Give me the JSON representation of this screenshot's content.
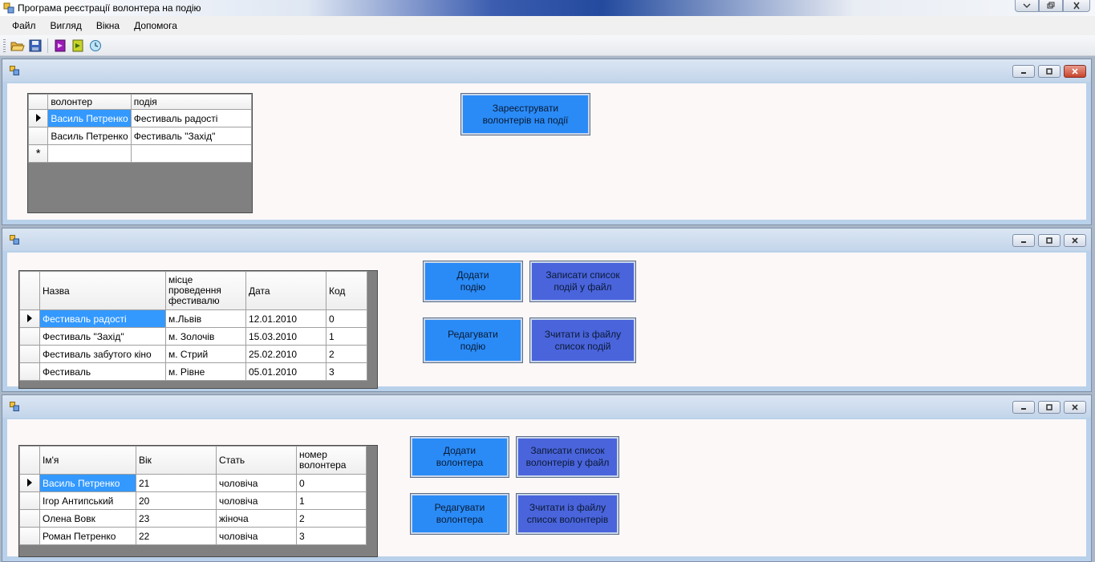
{
  "window": {
    "title": "Програма реєстрації волонтера на подію"
  },
  "menu": {
    "items": [
      "Файл",
      "Вигляд",
      "Вікна",
      "Допомога"
    ]
  },
  "toolbar": {
    "icons": [
      "open-folder-icon",
      "save-icon",
      "purple-book-icon",
      "yellow-book-icon",
      "clock-icon"
    ]
  },
  "registration": {
    "columns": [
      "волонтер",
      "подія"
    ],
    "rows": [
      [
        "Василь Петренко",
        "Фестиваль радості"
      ],
      [
        "Василь Петренко",
        "Фестиваль \"Захід\""
      ]
    ],
    "new_row_marker": "*",
    "register_button": "Зареєструвати волонтерів на події"
  },
  "events": {
    "columns": [
      "Назва",
      "місце проведення фестивалю",
      "Дата",
      "Код"
    ],
    "rows": [
      [
        "Фестиваль радості",
        "м.Львів",
        "12.01.2010",
        "0"
      ],
      [
        "Фестиваль \"Захід\"",
        "м. Золочів",
        "15.03.2010",
        "1"
      ],
      [
        "Фестиваль забутого кіно",
        "м. Стрий",
        "25.02.2010",
        "2"
      ],
      [
        "Фестиваль",
        "м.  Рівне",
        "05.01.2010",
        "3"
      ]
    ],
    "buttons": {
      "add": "Додати подію",
      "save": "Записати список подій у файл",
      "edit": "Редагувати подію",
      "load": "Зчитати із файлу список подій"
    }
  },
  "volunteers": {
    "columns": [
      "Ім'я",
      "Вік",
      "Стать",
      "номер волонтера"
    ],
    "rows": [
      [
        "Василь Петренко",
        "21",
        "чоловіча",
        "0"
      ],
      [
        "Ігор Антипський",
        "20",
        "чоловіча",
        "1"
      ],
      [
        "Олена Вовк",
        "23",
        "жіноча",
        "2"
      ],
      [
        "Роман Петренко",
        "22",
        "чоловіча",
        "3"
      ]
    ],
    "buttons": {
      "add": "Додати волонтера",
      "save": "Записати список волонтерів у файл",
      "edit": "Редагувати волонтера",
      "load": "Зчитати із файлу список волонтерів"
    }
  },
  "colors": {
    "button_blue": "#2a8bf7",
    "button_dark_blue": "#4a64dc",
    "selection": "#3399ff"
  }
}
